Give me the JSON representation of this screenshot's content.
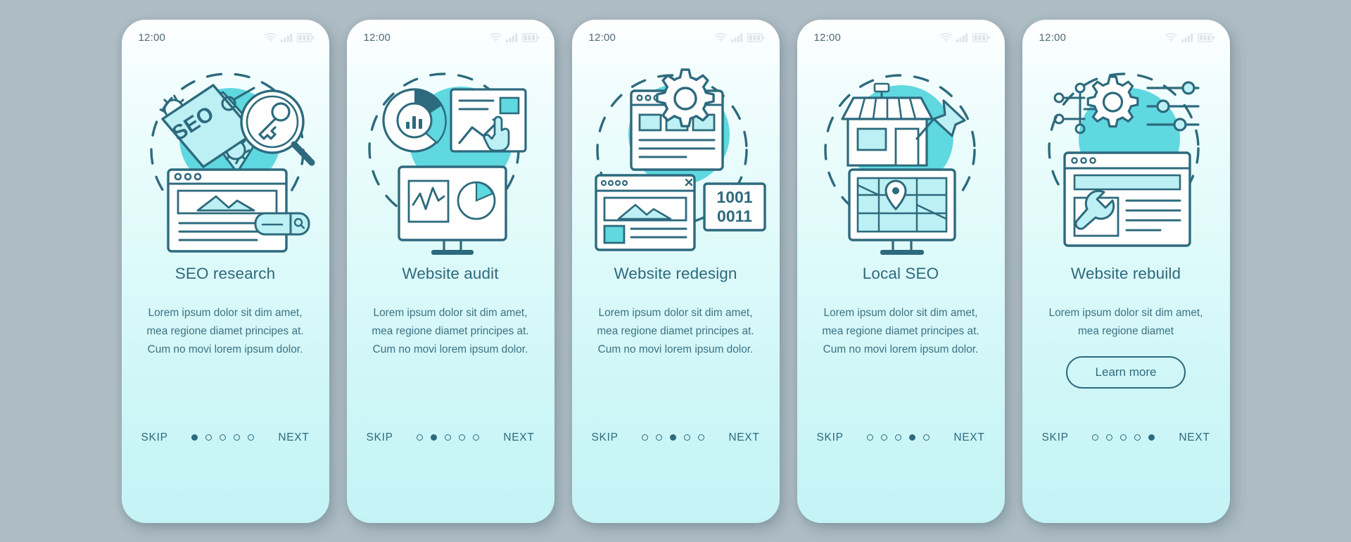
{
  "theme": {
    "background": "#aebcc4",
    "accent": "#2d6a7d",
    "line": "#2d6a7d",
    "fill_cyan": "#5fd8e0",
    "fill_light": "#bdf0f4",
    "status_icon": "#dfe6e9"
  },
  "screens": [
    {
      "status": {
        "time": "12:00",
        "wifi": "wifi-icon",
        "signal": "signal-icon",
        "battery": "battery-icon"
      },
      "illustration": "seo-research-illustration",
      "title": "SEO research",
      "body": "Lorem ipsum dolor sit dim amet, mea regione diamet principes at. Cum no movi lorem ipsum dolor.",
      "nav": {
        "skip": "SKIP",
        "next": "NEXT",
        "dots": 5,
        "active": 0
      },
      "cta": null
    },
    {
      "status": {
        "time": "12:00",
        "wifi": "wifi-icon",
        "signal": "signal-icon",
        "battery": "battery-icon"
      },
      "illustration": "website-audit-illustration",
      "title": "Website audit",
      "body": "Lorem ipsum dolor sit dim amet, mea regione diamet principes at. Cum no movi lorem ipsum dolor.",
      "nav": {
        "skip": "SKIP",
        "next": "NEXT",
        "dots": 5,
        "active": 1
      },
      "cta": null
    },
    {
      "status": {
        "time": "12:00",
        "wifi": "wifi-icon",
        "signal": "signal-icon",
        "battery": "battery-icon"
      },
      "illustration": "website-redesign-illustration",
      "title": "Website redesign",
      "body": "Lorem ipsum dolor sit dim amet, mea regione diamet principes at. Cum no movi lorem ipsum dolor.",
      "nav": {
        "skip": "SKIP",
        "next": "NEXT",
        "dots": 5,
        "active": 2
      },
      "cta": null
    },
    {
      "status": {
        "time": "12:00",
        "wifi": "wifi-icon",
        "signal": "signal-icon",
        "battery": "battery-icon"
      },
      "illustration": "local-seo-illustration",
      "title": "Local SEO",
      "body": "Lorem ipsum dolor sit dim amet, mea regione diamet principes at. Cum no movi lorem ipsum dolor.",
      "nav": {
        "skip": "SKIP",
        "next": "NEXT",
        "dots": 5,
        "active": 3
      },
      "cta": null
    },
    {
      "status": {
        "time": "12:00",
        "wifi": "wifi-icon",
        "signal": "signal-icon",
        "battery": "battery-icon"
      },
      "illustration": "website-rebuild-illustration",
      "title": "Website rebuild",
      "body": "Lorem ipsum dolor sit dim amet, mea regione diamet",
      "nav": {
        "skip": "SKIP",
        "next": "NEXT",
        "dots": 5,
        "active": 4
      },
      "cta": "Learn more"
    }
  ],
  "illustration_labels": {
    "seo_tag": "SEO",
    "binary_top": "1001",
    "binary_bottom": "0011"
  }
}
